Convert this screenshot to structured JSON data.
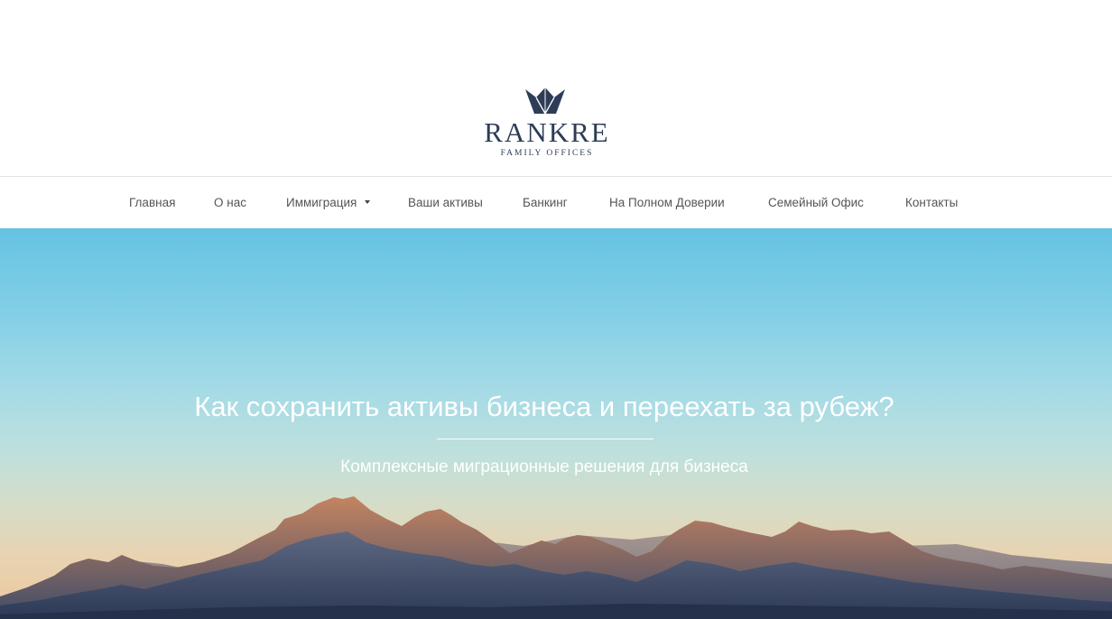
{
  "brand": {
    "name": "RANKRE",
    "tagline": "FAMILY OFFICES",
    "logo_icon": "crown-icon",
    "color": "#2e3c57"
  },
  "nav": {
    "items": [
      {
        "label": "Главная"
      },
      {
        "label": "О нас"
      },
      {
        "label": "Иммиграция",
        "has_dropdown": true,
        "icon": "chevron-down-icon"
      },
      {
        "label": "Ваши активы"
      },
      {
        "label": "Банкинг"
      },
      {
        "label": "На Полном Доверии"
      },
      {
        "label": "Семейный Офис"
      },
      {
        "label": "Контакты"
      }
    ]
  },
  "hero": {
    "title": "Как сохранить активы бизнеса и переехать за рубеж?",
    "subtitle": "Комплексные миграционные решения для бизнеса",
    "text_color": "#ffffff"
  }
}
